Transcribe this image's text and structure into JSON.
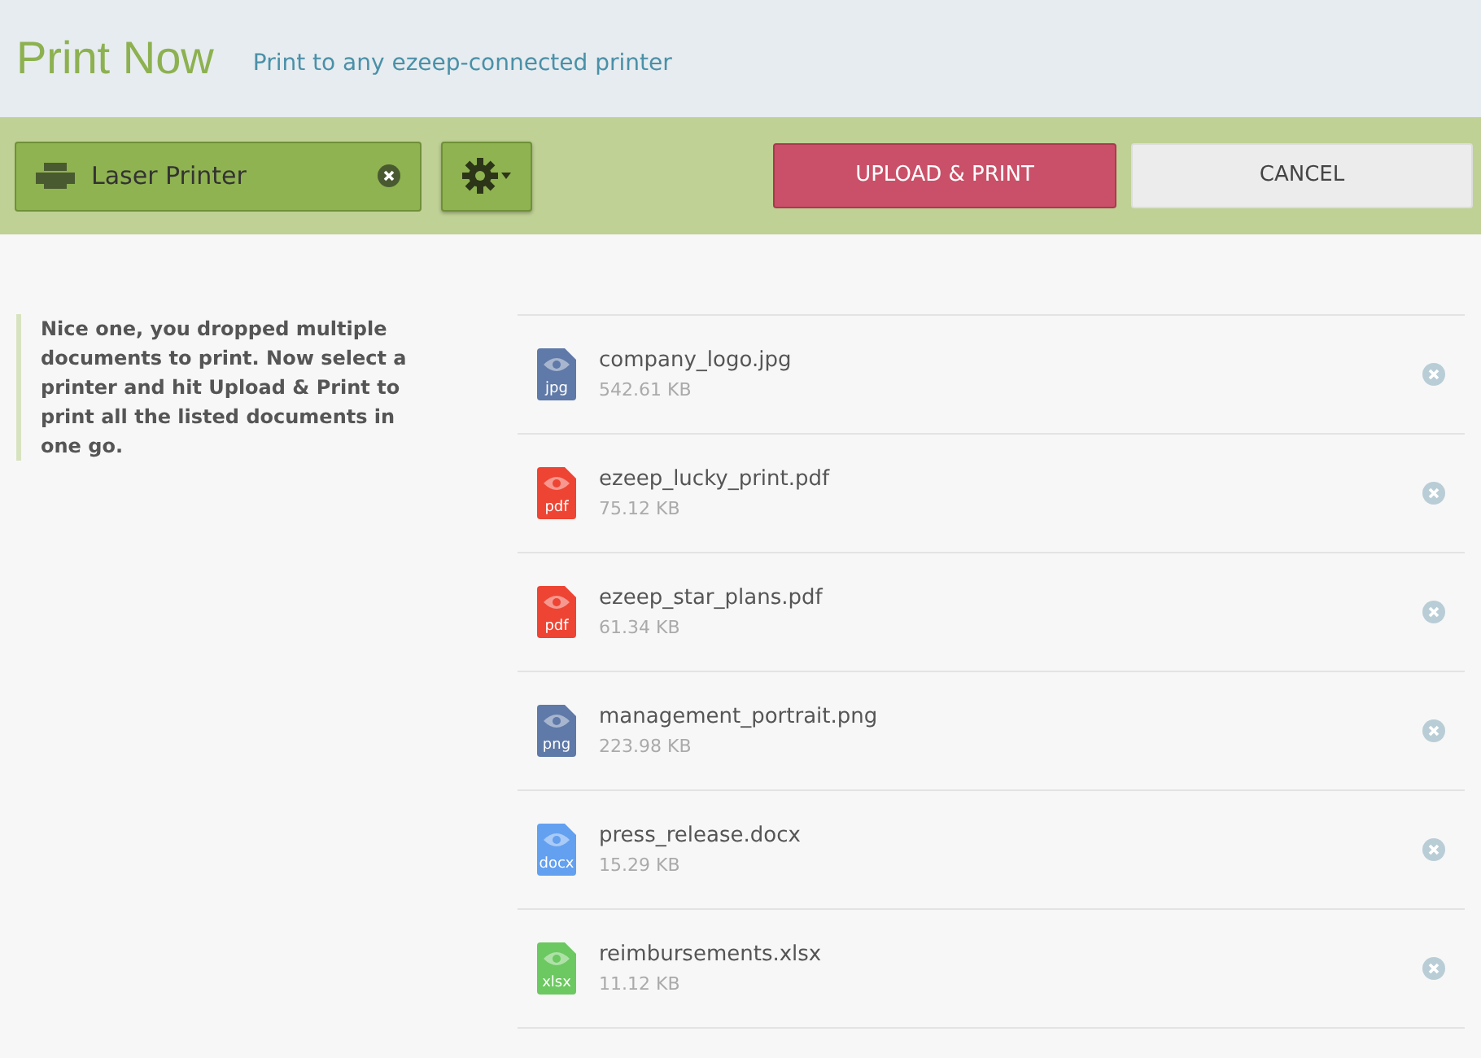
{
  "header": {
    "title": "Print Now",
    "subtitle": "Print to any ezeep-connected printer"
  },
  "toolbar": {
    "printer": "Laser Printer",
    "upload_button": "UPLOAD & PRINT",
    "cancel_button": "CANCEL"
  },
  "note": "Nice one, you dropped multiple documents to print. Now select a printer and hit Upload & Print to print all the listed documents in one go.",
  "files": [
    {
      "name": "company_logo.jpg",
      "size": "542.61 KB",
      "ext": "jpg",
      "color": "#5f79a8"
    },
    {
      "name": "ezeep_lucky_print.pdf",
      "size": "75.12 KB",
      "ext": "pdf",
      "color": "#ee4433"
    },
    {
      "name": "ezeep_star_plans.pdf",
      "size": "61.34 KB",
      "ext": "pdf",
      "color": "#ee4433"
    },
    {
      "name": "management_portrait.png",
      "size": "223.98 KB",
      "ext": "png",
      "color": "#5f79a8"
    },
    {
      "name": "press_release.docx",
      "size": "15.29 KB",
      "ext": "docx",
      "color": "#64a0f0"
    },
    {
      "name": "reimbursements.xlsx",
      "size": "11.12 KB",
      "ext": "xlsx",
      "color": "#6cc860"
    }
  ]
}
